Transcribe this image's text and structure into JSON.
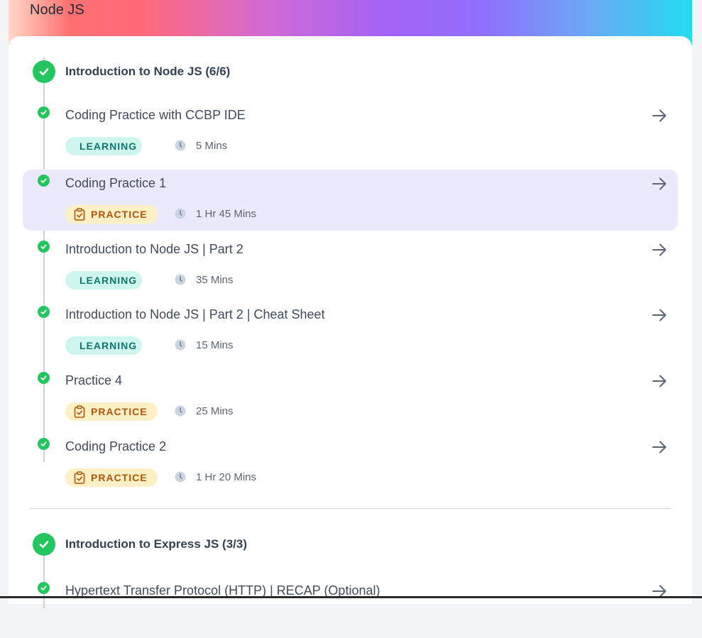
{
  "course": {
    "title": "Node JS"
  },
  "modules": [
    {
      "title": "Introduction to Node JS (6/6)",
      "items": [
        {
          "title": "Coding Practice with CCBP IDE",
          "type": "LEARNING",
          "duration": "5 Mins",
          "icon": "book-icon",
          "active": false
        },
        {
          "title": "Coding Practice 1",
          "type": "PRACTICE",
          "duration": "1 Hr 45 Mins",
          "icon": "clipboard-check-icon",
          "active": true
        },
        {
          "title": "Introduction to Node JS | Part 2",
          "type": "LEARNING",
          "duration": "35 Mins",
          "icon": "book-icon",
          "active": false
        },
        {
          "title": "Introduction to Node JS | Part 2 | Cheat Sheet",
          "type": "LEARNING",
          "duration": "15 Mins",
          "icon": "book-icon",
          "active": false
        },
        {
          "title": "Practice 4",
          "type": "PRACTICE",
          "duration": "25 Mins",
          "icon": "clipboard-check-icon",
          "active": false
        },
        {
          "title": "Coding Practice 2",
          "type": "PRACTICE",
          "duration": "1 Hr 20 Mins",
          "icon": "clipboard-check-icon",
          "active": false
        }
      ]
    },
    {
      "title": "Introduction to Express JS (3/3)",
      "items": [
        {
          "title": "Hypertext Transfer Protocol (HTTP) | RECAP (Optional)"
        }
      ]
    }
  ],
  "colors": {
    "check_green": "#22c55e",
    "learning_bg": "#cff6ee",
    "learning_text": "#0f766e",
    "practice_bg": "#fdf0c4",
    "practice_text": "#b45309",
    "active_row": "#ebe9fc"
  }
}
